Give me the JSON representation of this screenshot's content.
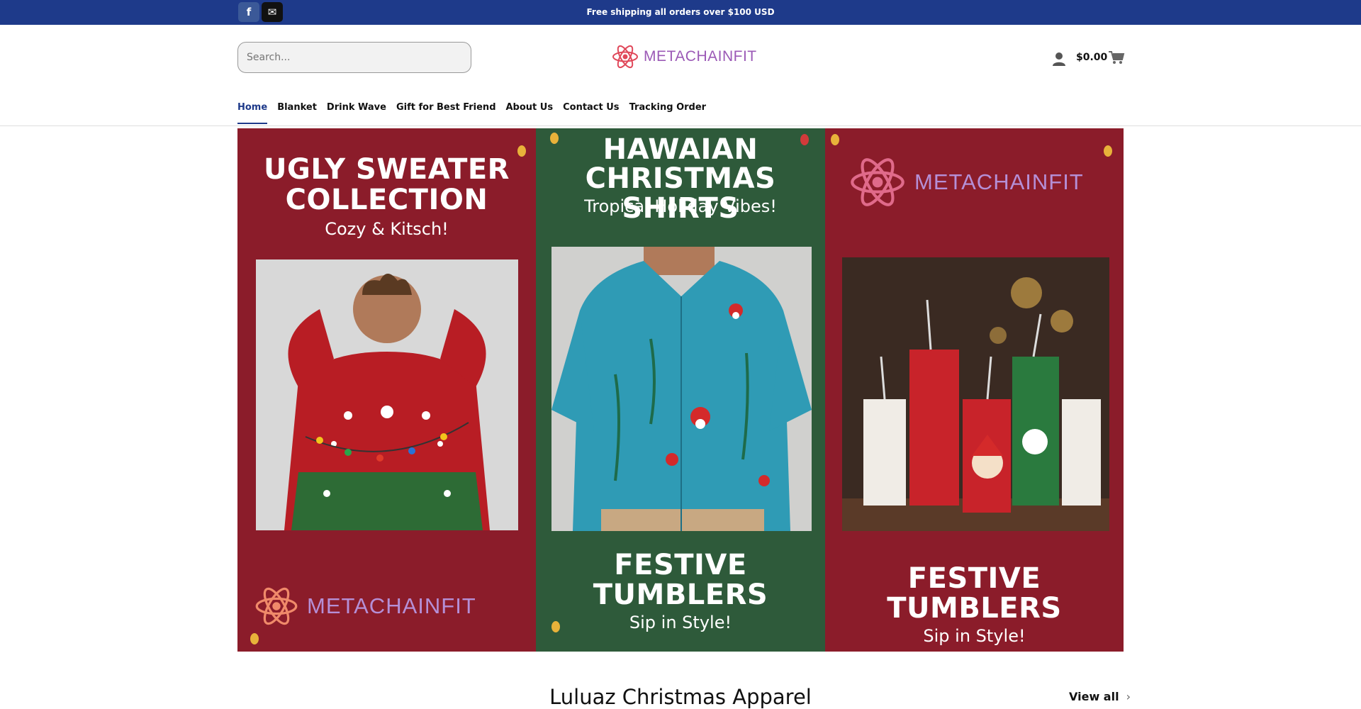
{
  "topbar": {
    "promo": "Free shipping all orders over $100 USD",
    "facebook_glyph": "f",
    "mail_glyph": "✉",
    "background_color": "#1e3a8a"
  },
  "header": {
    "search_placeholder": "Search...",
    "logo_text": "METACHAINFIT",
    "cart_total": "$0.00"
  },
  "nav": {
    "items": [
      {
        "label": "Home"
      },
      {
        "label": "Blanket"
      },
      {
        "label": "Drink Wave"
      },
      {
        "label": "Gift for Best Friend"
      },
      {
        "label": "About Us"
      },
      {
        "label": "Contact Us"
      },
      {
        "label": "Tracking Order"
      }
    ],
    "active_index": 0
  },
  "banner": {
    "panel1": {
      "title_line1": "UGLY SWEATER",
      "title_line2": "COLLECTION",
      "subtitle": "Cozy & Kitsch!",
      "logo_text": "METACHAINFIT"
    },
    "panel2": {
      "title_line1": "HAWAIAN",
      "title_line2": "CHRISTMAS SHIRTS",
      "subtitle": "Tropical Holiday Vibes!",
      "bottom_title_line1": "FESTIVE",
      "bottom_title_line2": "TUMBLERS",
      "bottom_subtitle": "Sip in Style!"
    },
    "panel3": {
      "logo_text": "METACHAINFIT",
      "bottom_title_line1": "FESTIVE",
      "bottom_title_line2": "TUMBLERS",
      "bottom_subtitle": "Sip in Style!"
    }
  },
  "section": {
    "title": "Luluaz Christmas Apparel",
    "view_all": "View all",
    "chevron_glyph": "›"
  }
}
